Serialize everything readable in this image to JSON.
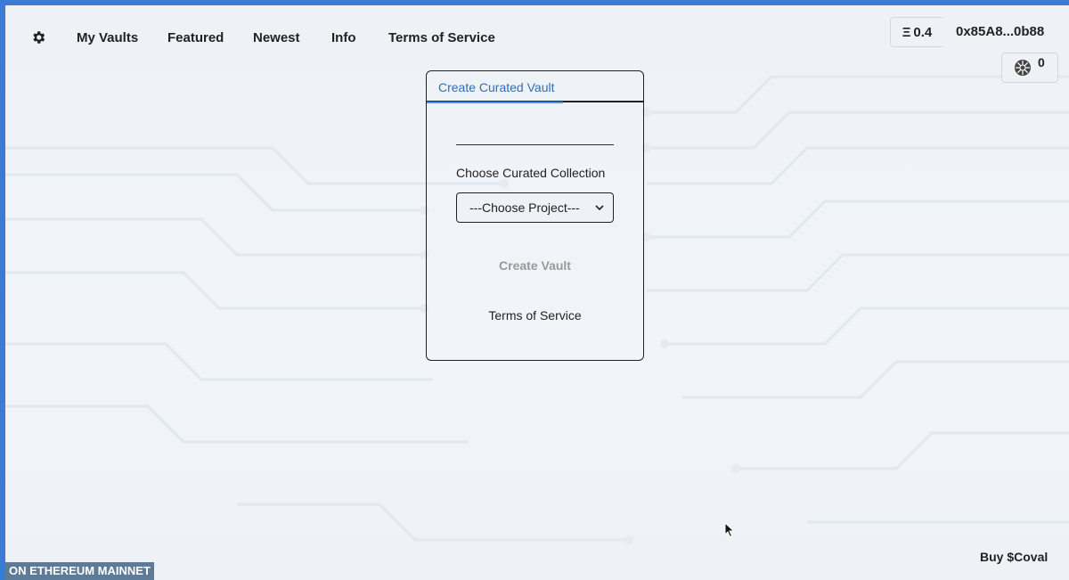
{
  "nav": {
    "settings_icon": "gear-icon",
    "links": [
      "My Vaults",
      "Featured",
      "Newest",
      "Info",
      "Terms of Service"
    ]
  },
  "wallet": {
    "currency_symbol": "Ξ",
    "balance": "0.4",
    "address": "0x85A8...0b88",
    "token_icon": "coval-token-icon",
    "token_count": "0"
  },
  "card": {
    "tab_label": "Create Curated Vault",
    "collection_label": "Choose Curated Collection",
    "select_value": "---Choose Project---",
    "create_button": "Create Vault",
    "tos_link": "Terms of Service"
  },
  "footer": {
    "network": "ON ETHEREUM MAINNET",
    "buy_link": "Buy $Coval"
  },
  "colors": {
    "frame_border": "#3a7bd5",
    "tab_accent": "#4a8fe0",
    "network_badge": "#5d7a98"
  }
}
